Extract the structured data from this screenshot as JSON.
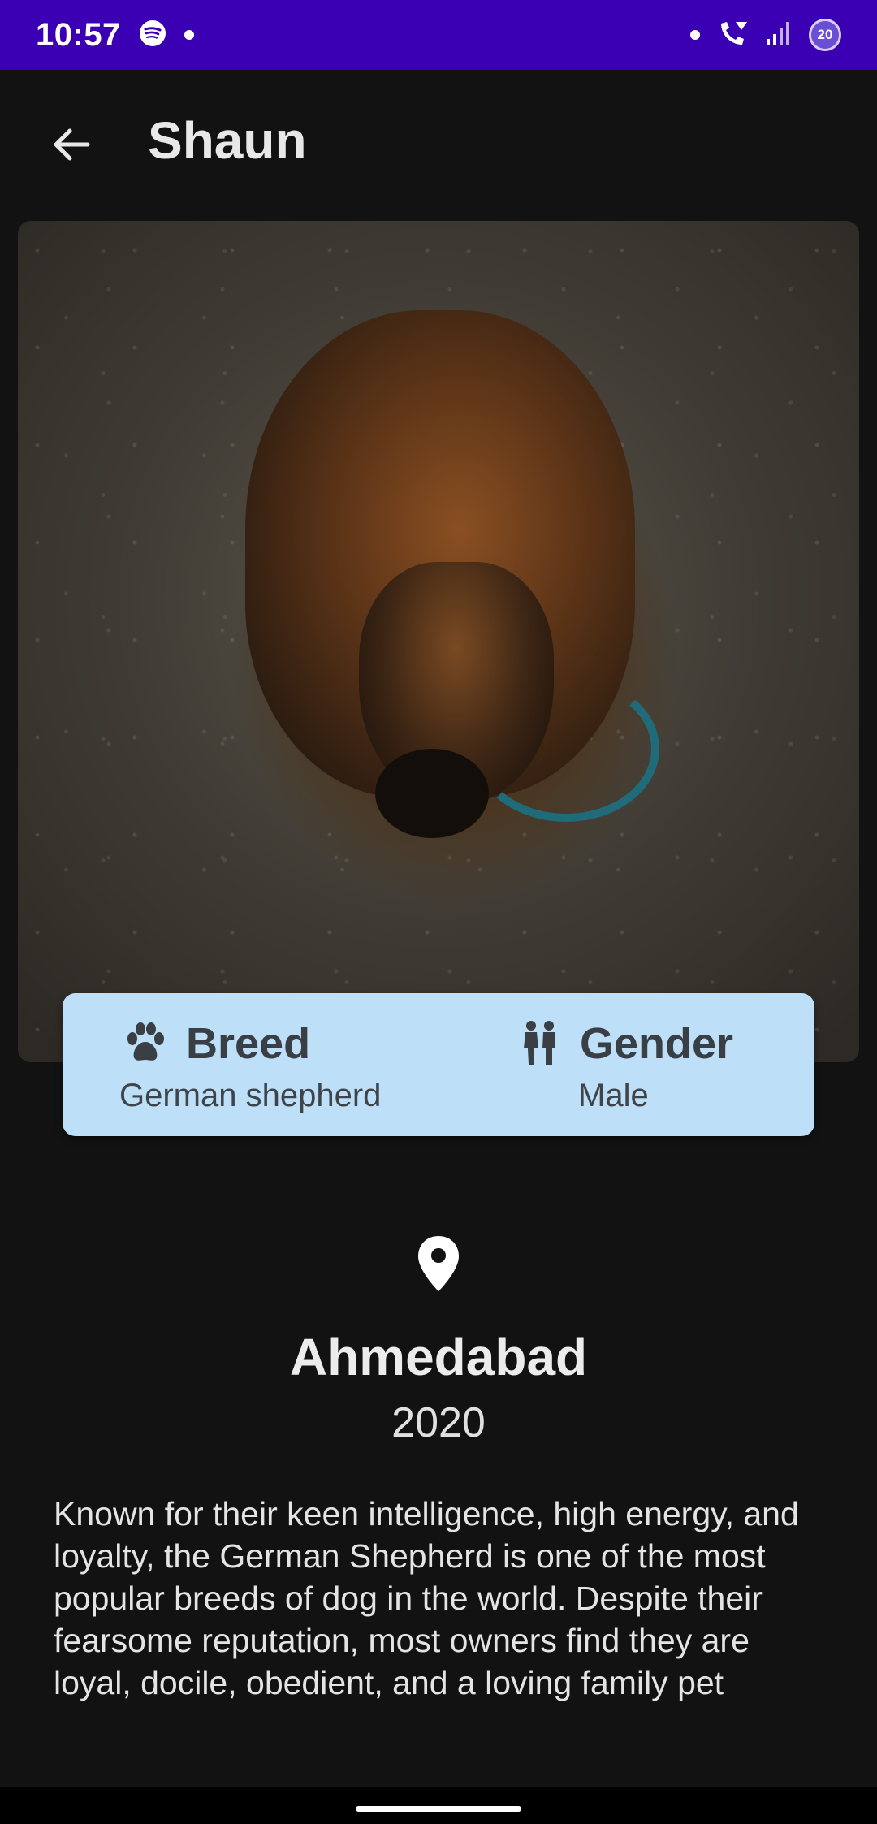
{
  "status_bar": {
    "time": "10:57",
    "badge": "20",
    "icons": [
      "spotify-icon",
      "notification-dot-icon",
      "dot-icon",
      "wifi-call-icon",
      "signal-icon",
      "battery-saver-icon"
    ]
  },
  "app_bar": {
    "title": "Shaun",
    "back_icon": "arrow-back-icon"
  },
  "hero": {
    "image": "dog-photo"
  },
  "info_card": {
    "breed_label": "Breed",
    "breed_value": "German shepherd",
    "breed_icon": "paw-icon",
    "gender_label": "Gender",
    "gender_value": "Male",
    "gender_icon": "gender-icon",
    "background_color": "#bddff8"
  },
  "location": {
    "icon": "location-pin-icon",
    "city": "Ahmedabad",
    "year": "2020"
  },
  "description": "Known for their keen intelligence, high energy, and loyalty, the German Shepherd is one of the most popular breeds of dog in the world. Despite their fearsome reputation, most owners find they are loyal, docile, obedient, and a loving family pet",
  "colors": {
    "status_bar": "#3b00b3",
    "background": "#121212",
    "card": "#bddff8"
  }
}
